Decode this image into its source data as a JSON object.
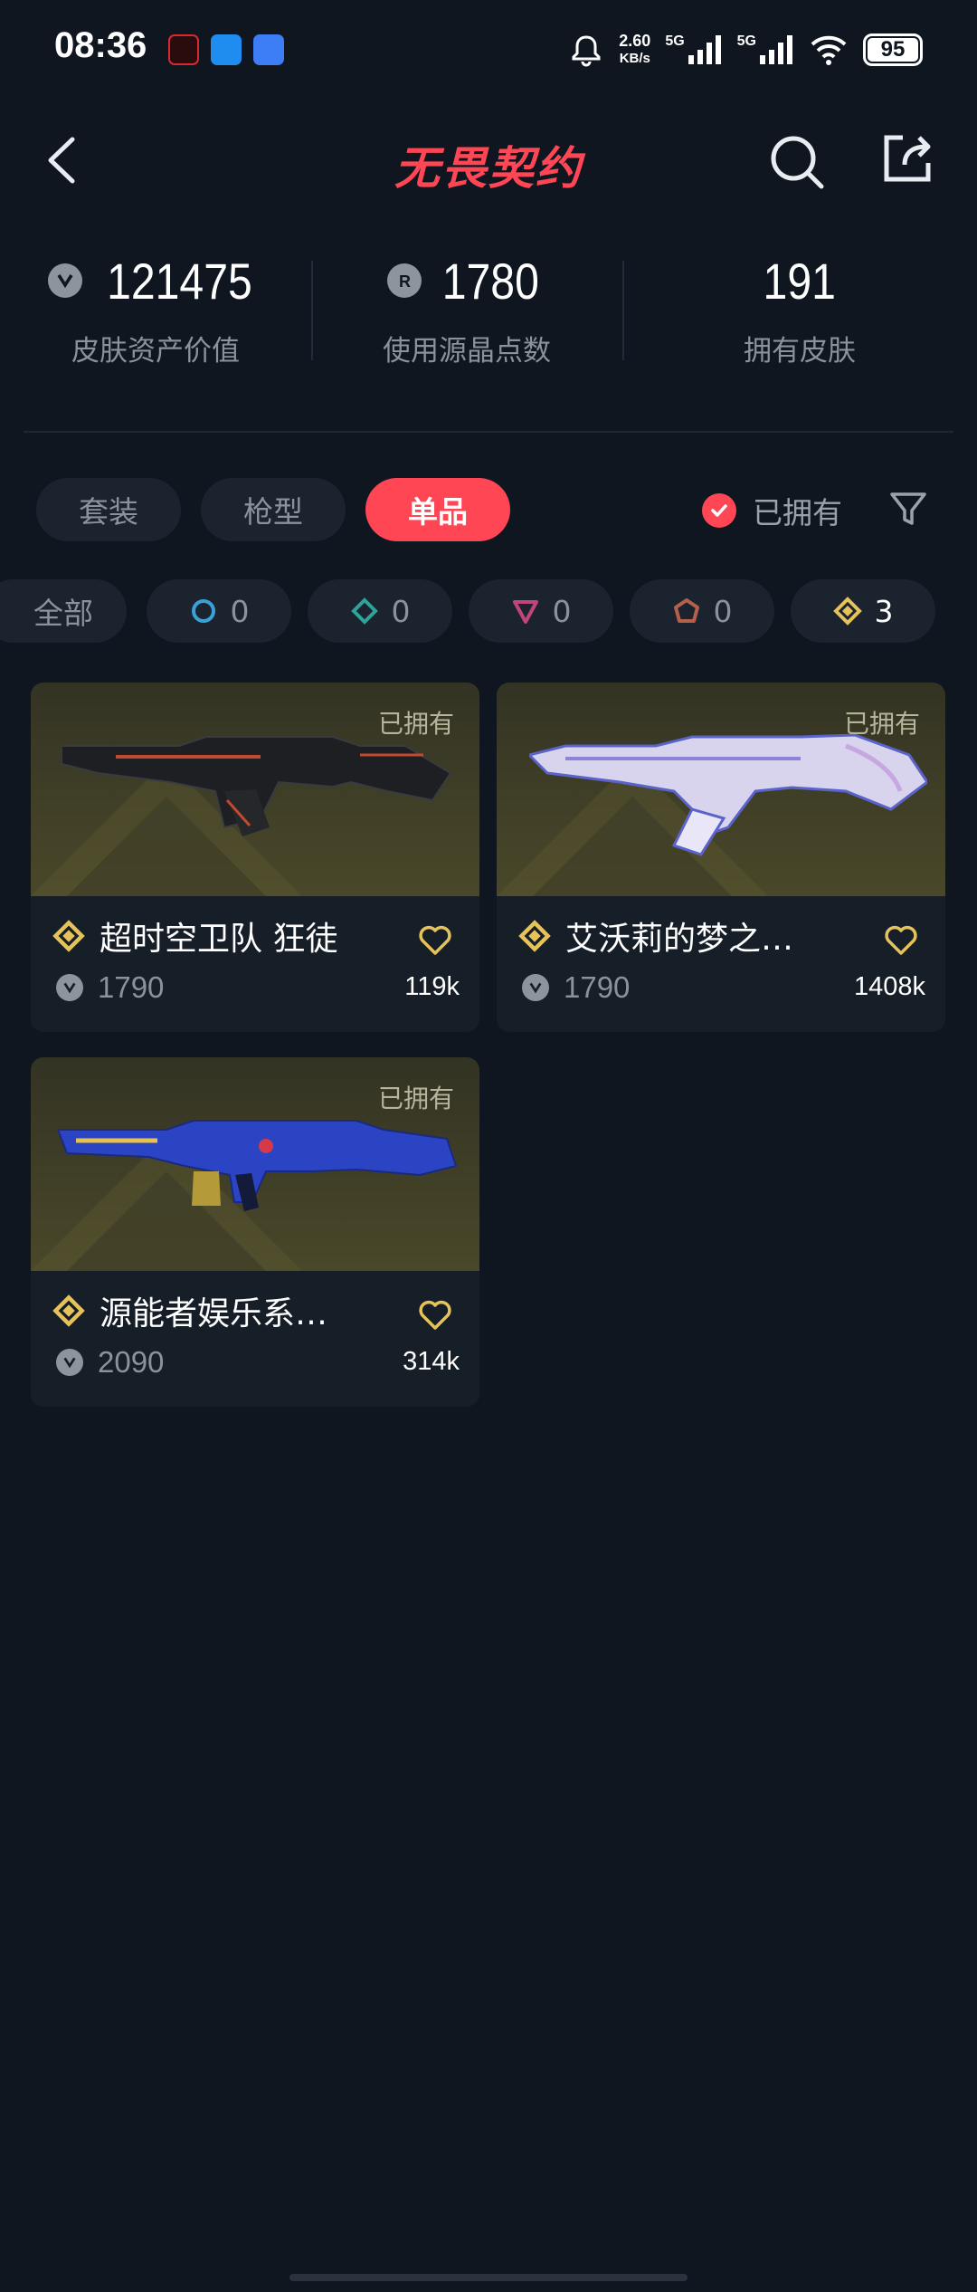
{
  "status_bar": {
    "time": "08:36",
    "net_speed_value": "2.60",
    "net_speed_unit": "KB/s",
    "sim1": "5G",
    "sim2": "5G",
    "battery": "95"
  },
  "header": {
    "title": "无畏契约"
  },
  "stats": [
    {
      "value": "121475",
      "label": "皮肤资产价值",
      "icon": "vp-coin-icon"
    },
    {
      "value": "1780",
      "label": "使用源晶点数",
      "icon": "radianite-icon"
    },
    {
      "value": "191",
      "label": "拥有皮肤"
    }
  ],
  "tabs": [
    {
      "label": "套装",
      "active": false
    },
    {
      "label": "枪型",
      "active": false
    },
    {
      "label": "单品",
      "active": true
    }
  ],
  "owned_filter": {
    "label": "已拥有",
    "checked": true
  },
  "rarity_chips": [
    {
      "label": "全部"
    },
    {
      "count": "0",
      "tier": "select",
      "color": "#3aa0d8"
    },
    {
      "count": "0",
      "tier": "deluxe",
      "color": "#2fa39a"
    },
    {
      "count": "0",
      "tier": "premium",
      "color": "#c2457a"
    },
    {
      "count": "0",
      "tier": "ultra",
      "color": "#b5604a"
    },
    {
      "count": "3",
      "tier": "exclusive",
      "color": "#e6c25a"
    }
  ],
  "cards": [
    {
      "owned_label": "已拥有",
      "name": "超时空卫队 狂徒",
      "price": "1790",
      "likes": "119k",
      "weapon_color": "#1e1f22",
      "accent": "#c44a2e"
    },
    {
      "owned_label": "已拥有",
      "name": "艾沃莉的梦之…",
      "price": "1790",
      "likes": "1408k",
      "weapon_color": "#d8d4ee",
      "accent": "#5a63c9"
    },
    {
      "owned_label": "已拥有",
      "name": "源能者娱乐系…",
      "price": "2090",
      "likes": "314k",
      "weapon_color": "#2b44c4",
      "accent": "#e8c24a"
    }
  ],
  "colors": {
    "background": "#0f1620",
    "accent_red": "#ff4655",
    "exclusive_gold": "#e6c25a"
  }
}
